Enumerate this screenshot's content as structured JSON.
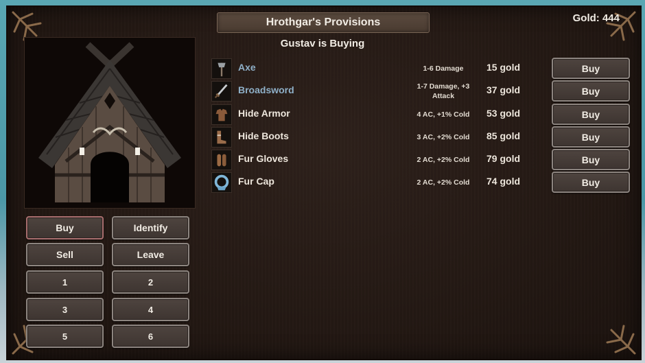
{
  "shop": {
    "title": "Hrothgar's Provisions",
    "gold_label": "Gold: 444",
    "buyer_line": "Gustav is Buying"
  },
  "items": [
    {
      "name": "Axe",
      "stats": "1-6 Damage",
      "price": "15 gold",
      "buy_label": "Buy",
      "icon": "axe-icon",
      "name_color": "#8fb0c8"
    },
    {
      "name": "Broadsword",
      "stats": "1-7 Damage, +3 Attack",
      "price": "37 gold",
      "buy_label": "Buy",
      "icon": "sword-icon",
      "name_color": "#8fb0c8"
    },
    {
      "name": "Hide Armor",
      "stats": "4 AC, +1% Cold",
      "price": "53 gold",
      "buy_label": "Buy",
      "icon": "armor-icon",
      "name_color": "#ede6dc"
    },
    {
      "name": "Hide Boots",
      "stats": "3 AC, +2% Cold",
      "price": "85 gold",
      "buy_label": "Buy",
      "icon": "boots-icon",
      "name_color": "#ede6dc"
    },
    {
      "name": "Fur Gloves",
      "stats": "2 AC, +2% Cold",
      "price": "79 gold",
      "buy_label": "Buy",
      "icon": "gloves-icon",
      "name_color": "#ede6dc"
    },
    {
      "name": "Fur Cap",
      "stats": "2 AC, +2% Cold",
      "price": "74 gold",
      "buy_label": "Buy",
      "icon": "cap-icon",
      "name_color": "#ede6dc"
    }
  ],
  "actions": {
    "buy": "Buy",
    "identify": "Identify",
    "sell": "Sell",
    "leave": "Leave"
  },
  "party_slots": [
    "1",
    "2",
    "3",
    "4",
    "5",
    "6"
  ],
  "colors": {
    "panel": "#231813",
    "button_border": "#8d8580",
    "active_border": "#a86e6e",
    "unusable_item": "#8fb0c8"
  }
}
